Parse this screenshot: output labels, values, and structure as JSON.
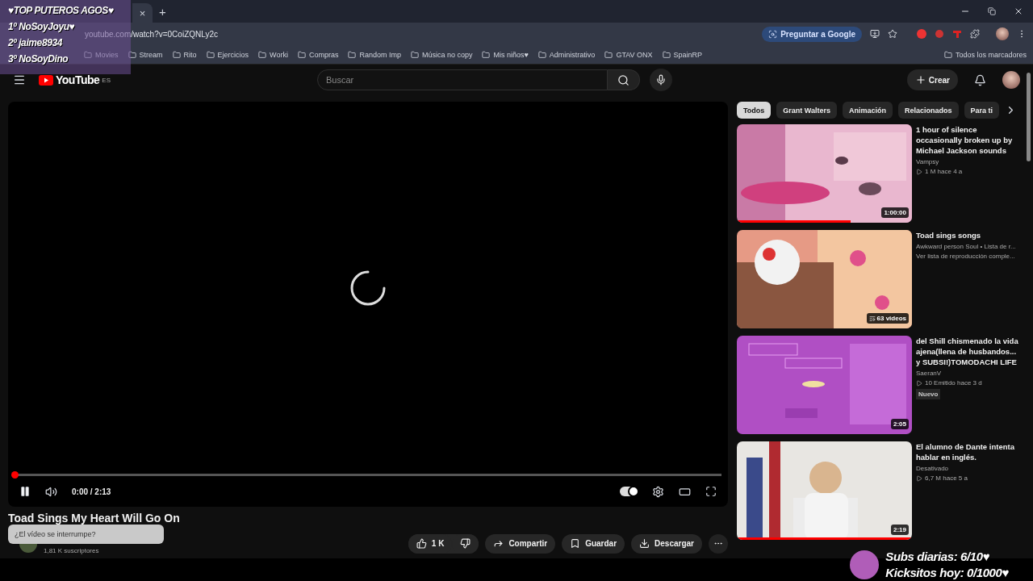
{
  "overlay_top": {
    "title": "♥TOP PUTEROS AGOS♥",
    "entries": [
      "1º NoSoyJoyu♥",
      "2º jaime8934",
      "3º NoSoyDino"
    ]
  },
  "browser": {
    "tab_close": "×",
    "new_tab": "+",
    "url": "youtube.com/watch?v=0CoiZQNLy2c",
    "ask_google": "Preguntar a Google",
    "bookmarks": [
      "Movies",
      "Stream",
      "Rito",
      "Ejercicios",
      "Worki",
      "Compras",
      "Random Imp",
      "Música no copy",
      "Mis niños♥",
      "Administrativo",
      "GTAV ONX",
      "SpainRP"
    ],
    "all_bookmarks": "Todos los marcadores"
  },
  "youtube": {
    "logo": "YouTube",
    "region": "ES",
    "search": {
      "placeholder": "Buscar"
    },
    "create": "Crear"
  },
  "player": {
    "time": "0:00 / 2:13",
    "progress": {
      "level": 0
    },
    "autoplay_on": true
  },
  "video": {
    "title": "Toad Sings My Heart Will Go On",
    "subscribers": "1,81 K suscriptores",
    "likes": "1 K",
    "actions": [
      "Compartir",
      "Guardar",
      "Descargar"
    ]
  },
  "tooltip": "¿El vídeo se interrumpe?",
  "chips": [
    {
      "label": "Todos",
      "selected": true
    },
    {
      "label": "Grant Walters",
      "selected": false
    },
    {
      "label": "Animación",
      "selected": false
    },
    {
      "label": "Relacionados",
      "selected": false
    },
    {
      "label": "Para ti",
      "selected": false
    }
  ],
  "recommendations": [
    {
      "kind": "video",
      "title": "1 hour of silence occasionally broken up by Michael Jackson sounds",
      "channel": "Vampsy",
      "meta": "1 M  hace 4 a",
      "badge": "1:00:00",
      "watched": {
        "level": 0.65
      }
    },
    {
      "kind": "playlist",
      "title": "Toad sings songs",
      "channel": "Awkward person Soul • Lista de r...",
      "meta": "Ver lista de reproducción comple...",
      "badge": "63 videos"
    },
    {
      "kind": "video",
      "title": "del Shill chismenado la vida ajena(llena de husbandos... y SUBSI!)TOMODACHI LIFE",
      "channel": "SaeranV",
      "meta": "10  Emitido hace 3 d",
      "badge": "2:05",
      "tag": "Nuevo"
    },
    {
      "kind": "video",
      "title": "El alumno de Dante intenta hablar en inglés.",
      "channel": "Desativado",
      "meta": "6,7 M  hace 5 a",
      "badge": "2:19",
      "watched": {
        "level": 1
      }
    }
  ],
  "overlay_bottom": {
    "lines": [
      "Subs diarias: 6/10♥",
      "Kicksitos hoy: 0/1000♥"
    ]
  }
}
